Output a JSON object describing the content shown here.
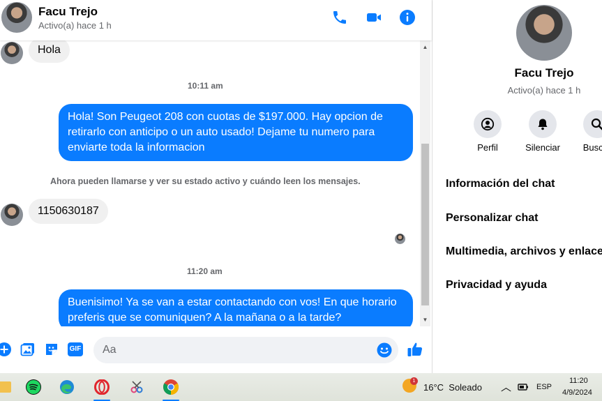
{
  "chat": {
    "contact_name": "Facu Trejo",
    "contact_status": "Activo(a) hace 1 h",
    "messages": [
      {
        "kind": "incoming",
        "text": "Hola"
      },
      {
        "kind": "time",
        "text": "10:11 am"
      },
      {
        "kind": "outgoing",
        "lines": [
          "Hola! Son Peugeot 208 con cuotas de $197.000. Hay opcion de",
          "retirarlo con anticipo o un auto usado! Dejame tu numero para",
          "enviarte toda la informacion"
        ]
      },
      {
        "kind": "system",
        "text": "Ahora pueden llamarse y ver su estado activo y cuándo leen los mensajes."
      },
      {
        "kind": "incoming",
        "text": "1150630187"
      },
      {
        "kind": "time",
        "text": "11:20 am"
      },
      {
        "kind": "outgoing",
        "lines": [
          "Buenisimo! Ya se van a estar contactando con vos! En que horario",
          "preferis que se comuniquen? A la mañana o a la tarde?"
        ]
      }
    ],
    "composer": {
      "placeholder": "Aa",
      "gif_label": "GIF"
    }
  },
  "info_panel": {
    "name": "Facu Trejo",
    "status": "Activo(a) hace 1 h",
    "actions": [
      {
        "label": "Perfil",
        "icon": "profile-icon"
      },
      {
        "label": "Silenciar",
        "icon": "bell-icon"
      },
      {
        "label": "Buscar",
        "icon": "search-icon"
      }
    ],
    "menu": [
      "Información del chat",
      "Personalizar chat",
      "Multimedia, archivos y enlaces",
      "Privacidad y ayuda"
    ]
  },
  "taskbar": {
    "apps": [
      "file-explorer-icon",
      "spotify-icon",
      "edge-icon",
      "opera-icon",
      "snipping-tool-icon",
      "chrome-icon"
    ],
    "weather_badge": "1",
    "weather": "16°C  Soleado",
    "language": "ESP",
    "time": "11:20",
    "date": "4/9/2024"
  },
  "colors": {
    "accent": "#0a7cff",
    "incoming_bubble": "#f0f0f0",
    "outgoing_bubble": "#0a7cff",
    "muted_text": "#65676b"
  }
}
